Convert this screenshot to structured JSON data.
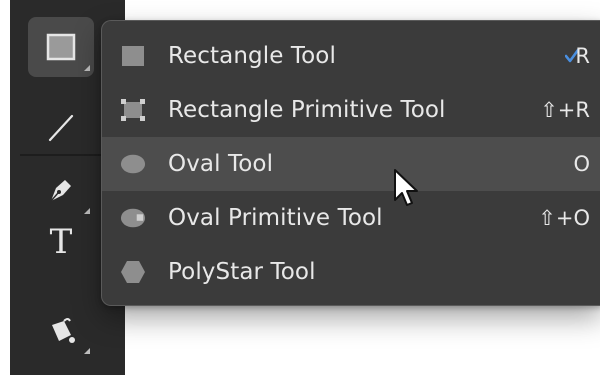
{
  "toolbar": {
    "tools": [
      {
        "name": "rectangle",
        "icon": "rectangle-icon",
        "selected": true
      },
      {
        "name": "line",
        "icon": "line-icon",
        "selected": false
      },
      {
        "name": "pen",
        "icon": "pen-icon",
        "selected": false
      },
      {
        "name": "text",
        "icon": "text-icon",
        "label": "T",
        "selected": false
      },
      {
        "name": "paint-bucket",
        "icon": "paint-bucket-icon",
        "selected": false
      }
    ]
  },
  "menu": {
    "items": [
      {
        "label": "Rectangle Tool",
        "shortcut": "R",
        "icon": "rectangle-icon",
        "checked": true
      },
      {
        "label": "Rectangle Primitive Tool",
        "shortcut": "⇧+R",
        "icon": "rectangle-primitive-icon"
      },
      {
        "label": "Oval Tool",
        "shortcut": "O",
        "icon": "oval-icon",
        "hovered": true
      },
      {
        "label": "Oval Primitive Tool",
        "shortcut": "⇧+O",
        "icon": "oval-primitive-icon"
      },
      {
        "label": "PolyStar Tool",
        "shortcut": "",
        "icon": "polystar-icon"
      }
    ]
  },
  "colors": {
    "toolbar_bg": "#2a2a2a",
    "menu_bg": "#3b3b3b",
    "menu_hover": "#4d4d4d",
    "text": "#e8e8e8",
    "check_accent": "#4a8fe0"
  }
}
